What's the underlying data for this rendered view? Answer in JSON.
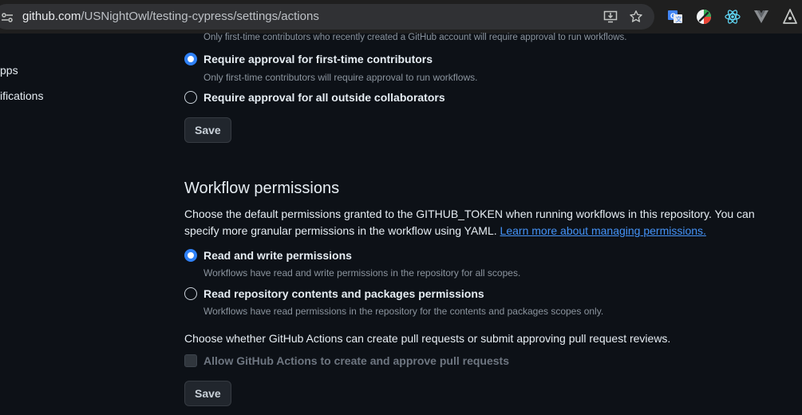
{
  "browser": {
    "url_host": "github.com",
    "url_path": "/USNightOwl/testing-cypress/settings/actions"
  },
  "sidebar": {
    "items": [
      {
        "label": "pps"
      },
      {
        "label": "ifications"
      }
    ]
  },
  "approval": {
    "cut_description": "Only first-time contributors who recently created a GitHub account will require approval to run workflows.",
    "options": [
      {
        "label": "Require approval for first-time contributors",
        "description": "Only first-time contributors will require approval to run workflows.",
        "checked": true
      },
      {
        "label": "Require approval for all outside collaborators",
        "description": "",
        "checked": false
      }
    ],
    "save_label": "Save"
  },
  "workflow_permissions": {
    "title": "Workflow permissions",
    "intro": "Choose the default permissions granted to the GITHUB_TOKEN when running workflows in this repository. You can specify more granular permissions in the workflow using YAML.",
    "link_text": "Learn more about managing permissions.",
    "options": [
      {
        "label": "Read and write permissions",
        "description": "Workflows have read and write permissions in the repository for all scopes.",
        "checked": true
      },
      {
        "label": "Read repository contents and packages permissions",
        "description": "Workflows have read permissions in the repository for the contents and packages scopes only.",
        "checked": false
      }
    ],
    "pr_question": "Choose whether GitHub Actions can create pull requests or submit approving pull request reviews.",
    "pr_checkbox_label": "Allow GitHub Actions to create and approve pull requests",
    "pr_checkbox_checked": false,
    "save_label": "Save"
  },
  "colors": {
    "accent": "#2f81f7",
    "link": "#4493f8",
    "background": "#0d1117"
  }
}
